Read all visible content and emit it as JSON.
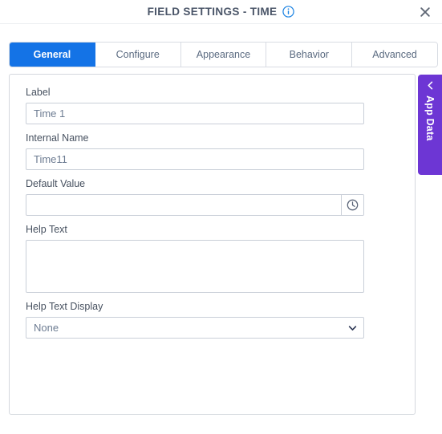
{
  "header": {
    "title": "FIELD SETTINGS - TIME",
    "info_icon": "info-circle-icon",
    "close_icon": "close-icon"
  },
  "tabs": [
    {
      "label": "General",
      "active": true
    },
    {
      "label": "Configure",
      "active": false
    },
    {
      "label": "Appearance",
      "active": false
    },
    {
      "label": "Behavior",
      "active": false
    },
    {
      "label": "Advanced",
      "active": false
    }
  ],
  "form": {
    "label": {
      "label": "Label",
      "value": "Time 1",
      "placeholder": "Time 1"
    },
    "internal_name": {
      "label": "Internal Name",
      "value": "Time11",
      "placeholder": "Time11"
    },
    "default_value": {
      "label": "Default Value",
      "value": "",
      "placeholder": "",
      "icon": "clock-icon"
    },
    "help_text": {
      "label": "Help Text",
      "value": "",
      "placeholder": ""
    },
    "help_text_display": {
      "label": "Help Text Display",
      "value": "None",
      "options": [
        "None"
      ],
      "icon": "chevron-down-icon"
    }
  },
  "app_data_panel": {
    "label": "App Data",
    "collapse_icon": "chevron-left-icon"
  },
  "colors": {
    "accent_blue": "#1473e6",
    "panel_purple": "#6d36d4",
    "text_dark": "#46505f",
    "input_text": "#6d7c92",
    "border": "#c9cfd8"
  }
}
